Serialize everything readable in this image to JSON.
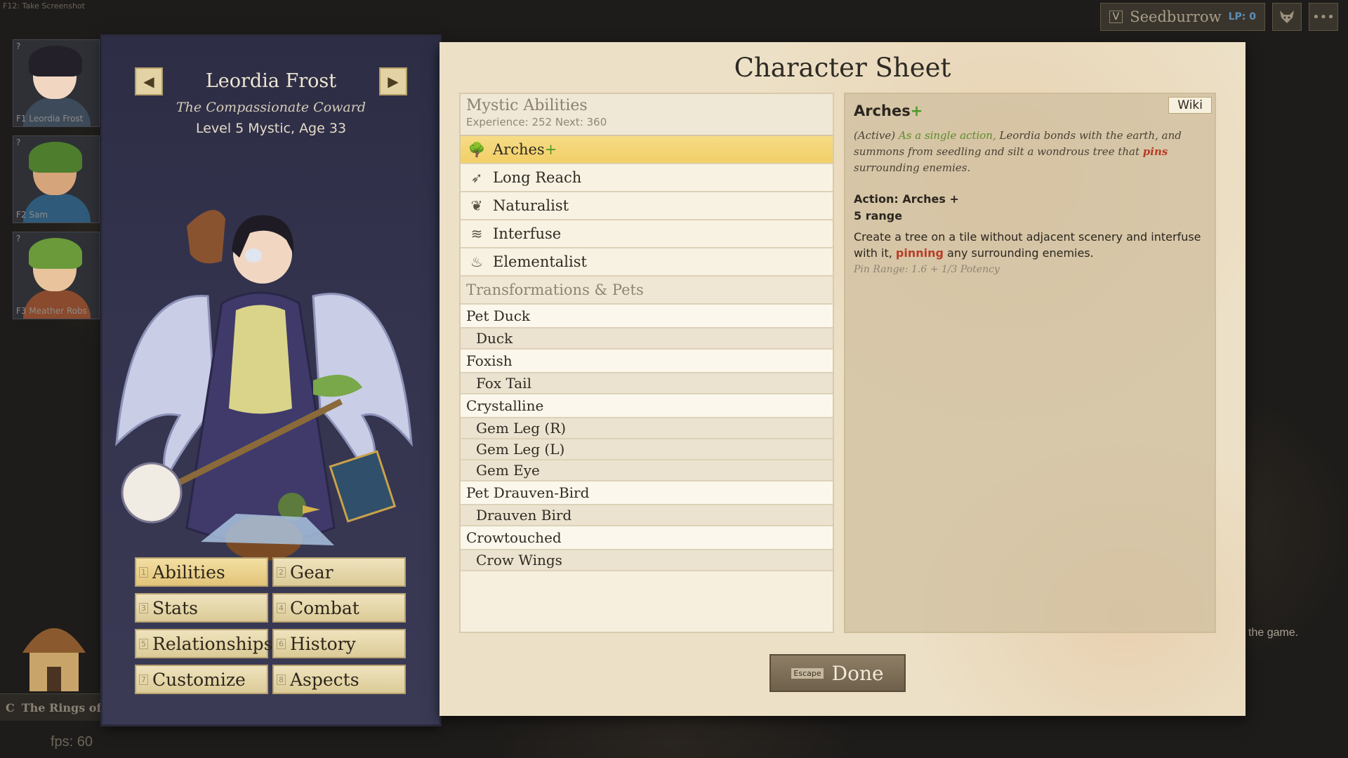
{
  "hint": "F12: Take Screenshot",
  "topbar": {
    "key": "V",
    "location": "Seedburrow",
    "lp_label": "LP: 0",
    "icons": [
      "wolf-head-icon",
      "menu-dots-icon"
    ]
  },
  "party": [
    {
      "num": "?",
      "name": "F1 Leordia Frost",
      "hair": "#23202a",
      "skin": "#f1d7c2"
    },
    {
      "num": "?",
      "name": "F2 Sam",
      "hair": "#4e7d2d",
      "skin": "#d6a47b"
    },
    {
      "num": "?",
      "name": "F3 Meather Robs",
      "hair": "#6b9a3b",
      "skin": "#e8c39c"
    }
  ],
  "background": {
    "right_text": "the game.",
    "quest_key": "C",
    "quest": "The Rings of St",
    "fps": "fps: 60"
  },
  "character": {
    "name": "Leordia Frost",
    "title": "The Compassionate Coward",
    "level": "Level 5 Mystic, Age 33",
    "prev": "◀",
    "next": "▶"
  },
  "tabs": [
    {
      "key": "1",
      "label": "Abilities",
      "active": true
    },
    {
      "key": "2",
      "label": "Gear"
    },
    {
      "key": "3",
      "label": "Stats"
    },
    {
      "key": "4",
      "label": "Combat"
    },
    {
      "key": "5",
      "label": "Relationships"
    },
    {
      "key": "6",
      "label": "History"
    },
    {
      "key": "7",
      "label": "Customize"
    },
    {
      "key": "8",
      "label": "Aspects"
    }
  ],
  "sheet": {
    "title": "Character Sheet",
    "abilities_header": "Mystic Abilities",
    "experience": "Experience: 252   Next: 360",
    "abilities": [
      {
        "label": "Arches",
        "plus": "+",
        "icon": "tree-icon",
        "glyph": "🌳"
      },
      {
        "label": "Long Reach",
        "icon": "reach-icon",
        "glyph": "➶"
      },
      {
        "label": "Naturalist",
        "icon": "vine-icon",
        "glyph": "❦"
      },
      {
        "label": "Interfuse",
        "icon": "wave-icon",
        "glyph": "≋"
      },
      {
        "label": "Elementalist",
        "icon": "flame-drop-icon",
        "glyph": "♨"
      }
    ],
    "transform_header": "Transformations & Pets",
    "transforms": [
      {
        "label": "Pet Duck",
        "sub": false
      },
      {
        "label": "Duck",
        "sub": true
      },
      {
        "label": "Foxish",
        "sub": false
      },
      {
        "label": "Fox Tail",
        "sub": true
      },
      {
        "label": "Crystalline",
        "sub": false
      },
      {
        "label": "Gem Leg (R)",
        "sub": true
      },
      {
        "label": "Gem Leg (L)",
        "sub": true
      },
      {
        "label": "Gem Eye",
        "sub": true
      },
      {
        "label": "Pet Drauven-Bird",
        "sub": false
      },
      {
        "label": "Drauven Bird",
        "sub": true
      },
      {
        "label": "Crowtouched",
        "sub": false
      },
      {
        "label": "Crow Wings",
        "sub": true
      }
    ]
  },
  "detail": {
    "wiki": "Wiki",
    "title": "Arches",
    "title_plus": "+",
    "desc_1": "(Active) ",
    "desc_green": "As a single action,",
    "desc_2": " Leordia bonds with the earth, and summons from seedling and silt a wondrous tree that ",
    "desc_red": "pins",
    "desc_3": " surrounding enemies.",
    "action": "Action: Arches +",
    "range": "5 range",
    "body_1": "Create a tree on a tile without adjacent scenery and interfuse with it, ",
    "body_red": "pinning",
    "body_2": " any surrounding enemies.",
    "pin_range": "Pin Range: 1.6 + 1/3 Potency"
  },
  "done": {
    "key": "Escape",
    "label": "Done"
  }
}
